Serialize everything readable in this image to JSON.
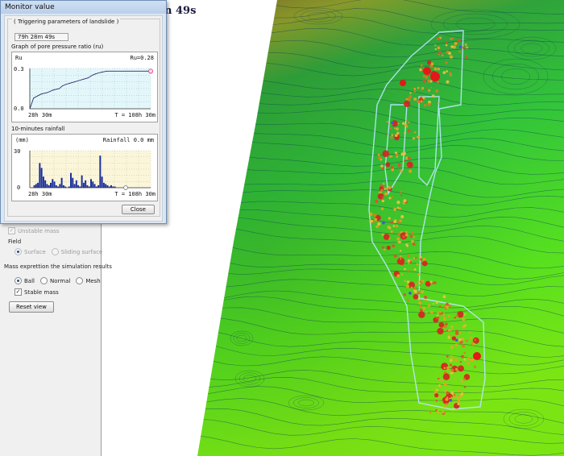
{
  "view": {
    "time_fragment": "n 49s"
  },
  "side_panel": {
    "unstable_mass_label": "Unstable mass",
    "field_label": "Field",
    "field_options": [
      "Surface",
      "Sliding surface"
    ],
    "mass_expr_label": "Mass exprettion the simulation results",
    "mass_options": [
      "Ball",
      "Normal",
      "Mesh"
    ],
    "mass_selected": "Ball",
    "stable_mass_label": "Stable mass",
    "reset_view_label": "Reset view"
  },
  "dialog": {
    "title": "Monitor value",
    "group_title": "( Triggering parameters of landslide )",
    "elapsed_time": "79h 28m 49s",
    "ru_chart_title": "Graph of pore pressure ratio (ru)",
    "ru_axis_name": "Ru",
    "ru_value_text": "Ru=0.28",
    "ru_ymax_label": "0.3",
    "ru_ymin_label": "0.0",
    "ru_x_start": "28h 30m",
    "ru_x_end": "T = 108h 30m",
    "rain_chart_title": "10-minutes rainfall",
    "rain_unit": "(mm)",
    "rain_value_text": "Rainfall 0.0 mm",
    "rain_ymax_label": "30",
    "rain_ymin_label": "0",
    "rain_x_start": "28h 30m",
    "rain_x_end": "T = 108h 30m",
    "close_label": "Close"
  },
  "chart_data": [
    {
      "type": "line",
      "title": "Graph of pore pressure ratio (ru)",
      "ylabel": "Ru",
      "ylim": [
        0,
        0.3
      ],
      "x_range_hours": [
        28.5,
        108.5
      ],
      "x_hours": [
        28.5,
        31,
        36,
        40,
        44,
        48,
        50,
        52,
        55,
        58,
        61,
        64,
        67,
        70,
        72,
        75,
        79.5,
        108.5
      ],
      "series": [
        {
          "values": [
            0.0,
            0.08,
            0.11,
            0.12,
            0.14,
            0.15,
            0.17,
            0.18,
            0.19,
            0.2,
            0.21,
            0.22,
            0.23,
            0.25,
            0.26,
            0.27,
            0.28,
            0.28
          ]
        }
      ],
      "current_point": {
        "x_hours": 108.5,
        "value": 0.28
      },
      "grid": true
    },
    {
      "type": "bar",
      "title": "10-minutes rainfall",
      "ylabel": "(mm)",
      "ylim": [
        0,
        30
      ],
      "x_range_hours": [
        28.5,
        108.5
      ],
      "values": [
        0,
        0,
        2,
        3,
        4,
        20,
        16,
        9,
        6,
        3,
        2,
        4,
        7,
        5,
        2,
        1,
        3,
        8,
        2,
        1,
        0,
        1,
        12,
        8,
        3,
        6,
        2,
        1,
        10,
        4,
        6,
        2,
        1,
        7,
        5,
        3,
        1,
        2,
        26,
        9,
        4,
        3,
        2,
        1,
        2,
        1,
        1,
        0,
        0,
        0,
        0,
        0,
        0,
        0,
        0,
        0,
        0,
        0,
        0,
        0,
        0,
        0,
        0,
        0,
        0,
        0
      ],
      "grid": true
    }
  ]
}
